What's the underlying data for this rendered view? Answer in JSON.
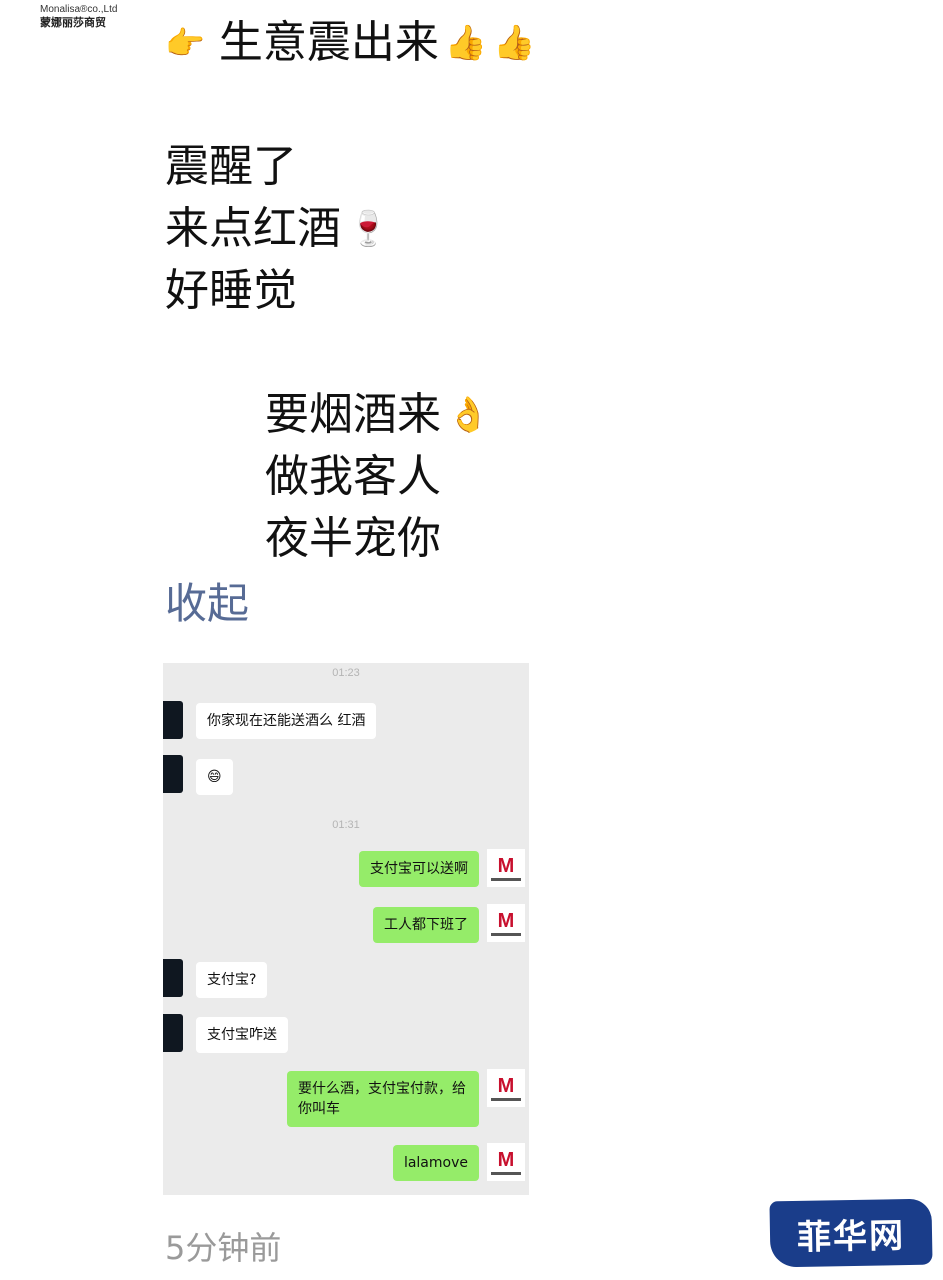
{
  "logo": {
    "brand_en": "Monalisa®co.,Ltd",
    "brand_cn": "蒙娜丽莎商贸"
  },
  "post": {
    "lines": [
      "生意震出来",
      "震醒了",
      "来点红酒",
      "好睡觉",
      "要烟酒来",
      "做我客人",
      "夜半宠你"
    ],
    "collapse_label": "收起",
    "time_ago": "5分钟前"
  },
  "icons": {
    "pointing_hand": "👉",
    "thumbs_up": "👍",
    "wine_glass": "🍷",
    "hand_gesture": "👌"
  },
  "chat": {
    "timestamp_1": "01:23",
    "timestamp_2": "01:31",
    "messages": [
      {
        "side": "in",
        "text": "你家现在还能送酒么 红酒"
      },
      {
        "side": "in",
        "text": "😄"
      },
      {
        "side": "out",
        "text": "支付宝可以送啊"
      },
      {
        "side": "out",
        "text": "工人都下班了"
      },
      {
        "side": "in",
        "text": "支付宝?"
      },
      {
        "side": "in",
        "text": "支付宝咋送"
      },
      {
        "side": "out",
        "text": "要什么酒，支付宝付款，给你叫车"
      },
      {
        "side": "out",
        "text": "lalamove"
      }
    ],
    "colors": {
      "background": "#ebebeb",
      "outgoing": "#95ec69",
      "incoming": "#ffffff"
    }
  },
  "watermark": {
    "text": "菲华网"
  },
  "colors": {
    "link": "#576b95",
    "muted": "#9a9a9a"
  }
}
